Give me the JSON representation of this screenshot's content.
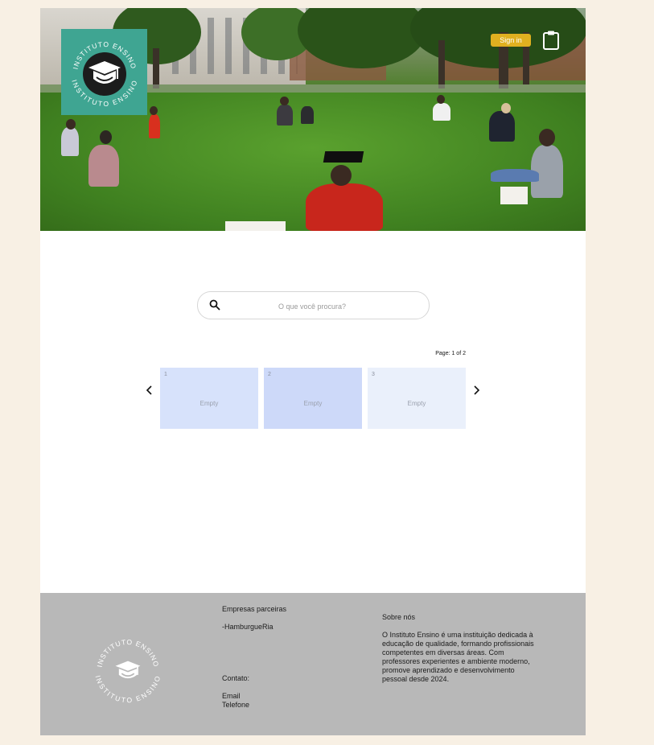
{
  "brand": {
    "ring_text_top": "INSTITUTO ENSINO",
    "ring_text_bottom": "INSTITUTO ENSINO",
    "logo_bg": "#3fa592"
  },
  "header": {
    "signin_label": "Sign in",
    "signin_color": "#e0b020",
    "cart_icon": "clipboard-icon"
  },
  "search": {
    "placeholder": "O que você procura?",
    "icon": "search-icon"
  },
  "pagination": {
    "label": "Page: 1 of 2",
    "current": 1,
    "total": 2
  },
  "cards": [
    {
      "number": "1",
      "label": "Empty",
      "color": "#d7e2fb"
    },
    {
      "number": "2",
      "label": "Empty",
      "color": "#cdd9f9"
    },
    {
      "number": "3",
      "label": "Empty",
      "color": "#eaf0fb"
    }
  ],
  "footer": {
    "partners_title": "Empresas parceiras",
    "partners": [
      "-HamburgueRia"
    ],
    "contact_title": "Contato:",
    "contact_items": [
      "Email",
      "Telefone"
    ],
    "about_title": "Sobre nós",
    "about_text": "O Instituto Ensino é uma instituição dedicada à educação de qualidade, formando profissionais competentes em diversas áreas. Com professores experientes e ambiente moderno, promove aprendizado e desenvolvimento pessoal desde 2024."
  }
}
